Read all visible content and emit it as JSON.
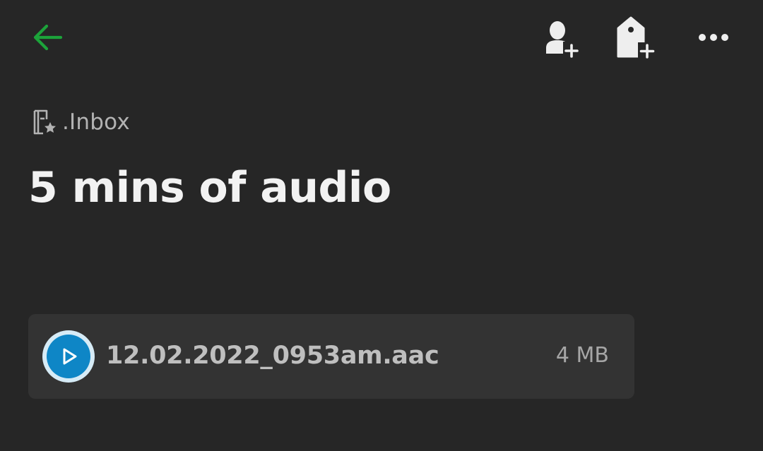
{
  "header": {
    "back_icon": "arrow-left-icon",
    "share_icon": "add-person-icon",
    "tag_icon": "add-tag-icon",
    "more_icon": "more-horizontal-icon"
  },
  "notebook": {
    "icon": "notebook-star-icon",
    "label": ".Inbox"
  },
  "note": {
    "title": "5 mins of audio"
  },
  "attachment": {
    "icon": "play-icon",
    "file_name": "12.02.2022_0953am.aac",
    "file_size": "4 MB"
  },
  "colors": {
    "background": "#262626",
    "accent_green": "#1ca33a",
    "play_blue": "#0e86c6",
    "card": "#333333"
  }
}
